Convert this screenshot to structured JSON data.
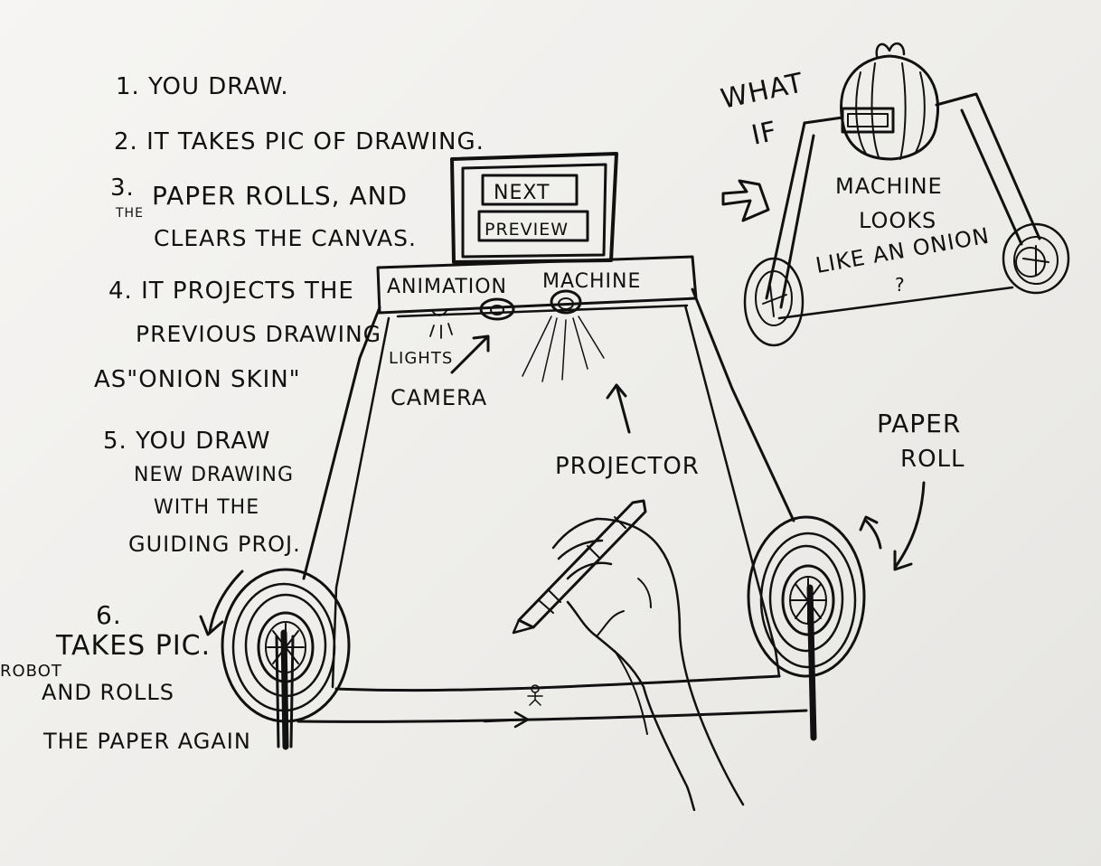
{
  "steps": [
    {
      "lines": [
        "1.  YOU DRAW."
      ]
    },
    {
      "lines": [
        "2.  IT TAKES PIC OF DRAWING."
      ]
    },
    {
      "lines": [
        "3.",
        "THE",
        "PAPER ROLLS, AND",
        "CLEARS THE CANVAS."
      ]
    },
    {
      "lines": [
        "4. IT PROJECTS THE",
        "PREVIOUS  DRAWING",
        "AS\"ONION SKIN\""
      ]
    },
    {
      "lines": [
        "5. YOU DRAW",
        "NEW DRAWING",
        "WITH THE",
        "GUIDING PROJ."
      ]
    },
    {
      "lines": [
        "6.",
        "ROBOT",
        "TAKES PIC.",
        "AND ROLLS",
        "THE PAPER AGAIN"
      ]
    }
  ],
  "machine": {
    "screen_buttons": [
      "NEXT",
      "PREVIEW"
    ],
    "title_left": "ANIMATION",
    "title_right": "MACHINE"
  },
  "labels": {
    "lights": "LIGHTS",
    "camera": "CAMERA",
    "projector": "PROJECTOR",
    "paper_roll_1": "PAPER",
    "paper_roll_2": "ROLL"
  },
  "what_if": {
    "line1": "WHAT",
    "line2": "IF",
    "body": [
      "MACHINE",
      "LOOKS",
      "LIKE AN ONION",
      "?"
    ]
  }
}
